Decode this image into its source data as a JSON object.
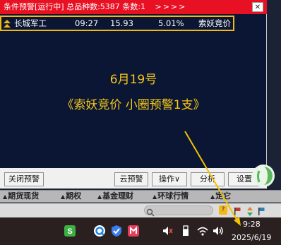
{
  "window": {
    "title": "条件预警[运行中] 总品种数:5387 条数:1",
    "title_arrows": ">>>>",
    "close_glyph": "✕"
  },
  "alert_row": {
    "name": "长城军工",
    "time": "09:27",
    "price": "15.93",
    "change_pct": "5.01%",
    "condition": "索妖竞价",
    "icon": "double-up-arrow-icon"
  },
  "annotation": {
    "line1": "6月19号",
    "line2": "《索妖竞价  小圈预警1支》"
  },
  "buttons": {
    "close_alert": "关闭预警",
    "cloud_alert": "云预警",
    "action": "操作∨",
    "analyze": "分析",
    "settings": "设置"
  },
  "tabs": [
    "期货现货",
    "期权",
    "基金理财",
    "环球行情",
    "定制版",
    "其它"
  ],
  "tab_labels_visible": [
    "期货现货",
    "期权",
    "基金理财",
    "环球行情",
    "定它"
  ],
  "taskbar": {
    "time": "9:28",
    "date": "2025/6/19"
  },
  "colors": {
    "title_bar": "#e81123",
    "panel_bg": "#0a1633",
    "highlight": "#f2b90f",
    "annotation_text": "#f6c719"
  }
}
